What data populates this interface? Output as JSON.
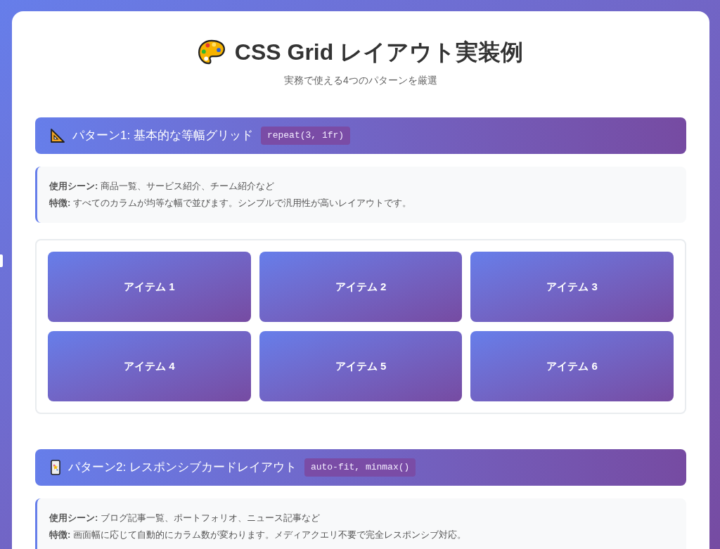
{
  "header": {
    "title": "CSS Grid レイアウト実装例",
    "subtitle": "実務で使える4つのパターンを厳選"
  },
  "sections": [
    {
      "title": "パターン1: 基本的な等幅グリッド",
      "code": "repeat(3, 1fr)",
      "description": [
        "**使用シーン:** 商品一覧、サービス紹介、チーム紹介など",
        "**特徴:** すべてのカラムが均等な幅で並びます。シンプルで汎用性が高いレイアウトです。"
      ],
      "demo": {
        "items": [
          "アイテム 1",
          "アイテム 2",
          "アイテム 3",
          "アイテム 4",
          "アイテム 5",
          "アイテム 6"
        ]
      }
    },
    {
      "title": "パターン2: レスポンシブカードレイアウト",
      "code": "auto-fit, minmax()",
      "description": [
        "**使用シーン:** ブログ記事一覧、ポートフォリオ、ニュース記事など",
        "**特徴:** 画面幅に応じて自動的にカラム数が変わります。メディアクエリ不要で完全レスポンシブ対応。"
      ]
    }
  ]
}
